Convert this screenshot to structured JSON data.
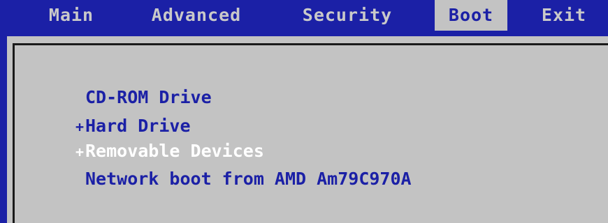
{
  "menu": {
    "tabs": [
      {
        "label": "Main"
      },
      {
        "label": "Advanced"
      },
      {
        "label": "Security"
      },
      {
        "label": "Boot"
      },
      {
        "label": "Exit"
      }
    ],
    "active": "Boot"
  },
  "boot": {
    "items": [
      {
        "label": "CD-ROM Drive",
        "expander": ""
      },
      {
        "label": "Hard Drive",
        "expander": "+"
      },
      {
        "label": "Removable Devices",
        "expander": "+"
      },
      {
        "label": "Network boot from AMD Am79C970A",
        "expander": ""
      }
    ],
    "selected": "Removable Devices"
  },
  "colors": {
    "background": "#1b20a6",
    "panel": "#c3c3c3",
    "text": "#1b20a6",
    "highlight": "#ffffff",
    "tab_text": "#c9c9c9"
  }
}
